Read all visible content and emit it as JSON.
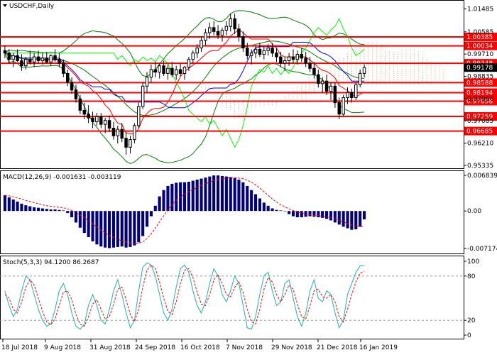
{
  "chart_data": {
    "type": "candlestick-with-indicators",
    "symbol_label": "USDCHF,Daily",
    "price_panel": {
      "ylim": [
        0.9525,
        1.0178
      ],
      "y_ticks": [
        1.01485,
        1.00585,
        0.9971,
        0.98835,
        0.9796,
        0.97085,
        0.9621,
        0.95335
      ],
      "y_tick_labels": [
        "1.01485",
        "1.00585",
        "0.99710",
        "0.98835",
        "0.97960",
        "0.97085",
        "0.96210",
        "0.95335"
      ],
      "horizontal_levels": [
        1.00385,
        1.00034,
        0.99348,
        0.98588,
        0.98194,
        0.97858,
        0.97259,
        0.96685
      ],
      "horizontal_level_labels": [
        "1.00385",
        "1.00034",
        "0.99348",
        "0.98588",
        "0.98194",
        "0.97858",
        "0.97259",
        "0.96685"
      ],
      "current_price": 0.99178,
      "current_price_label": "0.99178",
      "candles": [
        [
          0.9985,
          1.0005,
          0.9955,
          0.9975
        ],
        [
          0.9975,
          0.999,
          0.9935,
          0.995
        ],
        [
          0.995,
          0.9975,
          0.992,
          0.9965
        ],
        [
          0.9965,
          0.999,
          0.994,
          0.9945
        ],
        [
          0.9945,
          0.997,
          0.9905,
          0.9925
        ],
        [
          0.9925,
          0.996,
          0.991,
          0.995
        ],
        [
          0.995,
          0.9985,
          0.993,
          0.994
        ],
        [
          0.994,
          0.9975,
          0.992,
          0.996
        ],
        [
          0.996,
          0.9985,
          0.9935,
          0.9945
        ],
        [
          0.9945,
          0.9975,
          0.993,
          0.9955
        ],
        [
          0.9955,
          0.998,
          0.9935,
          0.994
        ],
        [
          0.994,
          0.997,
          0.9925,
          0.9965
        ],
        [
          0.9965,
          0.999,
          0.994,
          0.995
        ],
        [
          0.995,
          0.9975,
          0.992,
          0.9935
        ],
        [
          0.9935,
          0.995,
          0.988,
          0.9895
        ],
        [
          0.9895,
          0.991,
          0.9845,
          0.986
        ],
        [
          0.986,
          0.988,
          0.9815,
          0.983
        ],
        [
          0.983,
          0.985,
          0.978,
          0.9795
        ],
        [
          0.9795,
          0.981,
          0.9735,
          0.975
        ],
        [
          0.975,
          0.978,
          0.9715,
          0.9735
        ],
        [
          0.9735,
          0.977,
          0.97,
          0.972
        ],
        [
          0.972,
          0.9745,
          0.968,
          0.9705
        ],
        [
          0.9705,
          0.974,
          0.969,
          0.9725
        ],
        [
          0.9725,
          0.974,
          0.968,
          0.9695
        ],
        [
          0.9695,
          0.972,
          0.966,
          0.971
        ],
        [
          0.971,
          0.973,
          0.9665,
          0.968
        ],
        [
          0.968,
          0.9705,
          0.9635,
          0.965
        ],
        [
          0.965,
          0.969,
          0.962,
          0.9675
        ],
        [
          0.9675,
          0.97,
          0.9625,
          0.964
        ],
        [
          0.964,
          0.9665,
          0.9575,
          0.9605
        ],
        [
          0.9605,
          0.965,
          0.958,
          0.9635
        ],
        [
          0.9635,
          0.97,
          0.962,
          0.969
        ],
        [
          0.969,
          0.978,
          0.968,
          0.9765
        ],
        [
          0.9765,
          0.986,
          0.9755,
          0.9845
        ],
        [
          0.9845,
          0.99,
          0.982,
          0.988
        ],
        [
          0.988,
          0.993,
          0.986,
          0.991
        ],
        [
          0.991,
          0.994,
          0.988,
          0.99
        ],
        [
          0.99,
          0.9935,
          0.9875,
          0.9925
        ],
        [
          0.9925,
          0.9945,
          0.9885,
          0.9895
        ],
        [
          0.9895,
          0.993,
          0.987,
          0.9915
        ],
        [
          0.9915,
          0.994,
          0.988,
          0.989
        ],
        [
          0.989,
          0.9925,
          0.987,
          0.991
        ],
        [
          0.991,
          0.9935,
          0.9885,
          0.9895
        ],
        [
          0.9895,
          0.9925,
          0.987,
          0.992
        ],
        [
          0.992,
          0.996,
          0.9905,
          0.995
        ],
        [
          0.995,
          0.9985,
          0.9935,
          0.9975
        ],
        [
          0.9975,
          1.001,
          0.9955,
          0.9995
        ],
        [
          0.9995,
          1.004,
          0.998,
          1.0025
        ],
        [
          1.0025,
          1.007,
          1.0005,
          1.0055
        ],
        [
          1.0055,
          1.0095,
          1.003,
          1.0075
        ],
        [
          1.0075,
          1.01,
          1.0045,
          1.006
        ],
        [
          1.006,
          1.0085,
          1.003,
          1.0045
        ],
        [
          1.0045,
          1.0075,
          1.002,
          1.0065
        ],
        [
          1.0065,
          1.01,
          1.0045,
          1.008
        ],
        [
          1.008,
          1.013,
          1.006,
          1.011
        ],
        [
          1.011,
          1.013,
          1.005,
          1.007
        ],
        [
          1.007,
          1.009,
          1.002,
          1.004
        ],
        [
          1.004,
          1.006,
          0.998,
          0.9995
        ],
        [
          0.9995,
          1.0015,
          0.995,
          0.9965
        ],
        [
          0.9965,
          0.999,
          0.993,
          0.9975
        ],
        [
          0.9975,
          1.0005,
          0.9955,
          0.999
        ],
        [
          0.999,
          1.0015,
          0.996,
          0.997
        ],
        [
          0.997,
          1.0,
          0.995,
          0.9985
        ],
        [
          0.9985,
          1.001,
          0.9965,
          0.9995
        ],
        [
          0.9995,
          1.0015,
          0.996,
          0.9975
        ],
        [
          0.9975,
          0.9995,
          0.994,
          0.996
        ],
        [
          0.996,
          0.998,
          0.992,
          0.9935
        ],
        [
          0.9935,
          0.996,
          0.9905,
          0.9945
        ],
        [
          0.9945,
          0.9975,
          0.9925,
          0.996
        ],
        [
          0.996,
          0.999,
          0.9935,
          0.995
        ],
        [
          0.995,
          0.9985,
          0.993,
          0.997
        ],
        [
          0.997,
          0.9995,
          0.994,
          0.9955
        ],
        [
          0.9955,
          0.998,
          0.992,
          0.9935
        ],
        [
          0.9935,
          0.996,
          0.99,
          0.9915
        ],
        [
          0.9915,
          0.994,
          0.9875,
          0.989
        ],
        [
          0.989,
          0.991,
          0.984,
          0.9855
        ],
        [
          0.9855,
          0.988,
          0.982,
          0.9865
        ],
        [
          0.9865,
          0.989,
          0.981,
          0.9825
        ],
        [
          0.9825,
          0.986,
          0.979,
          0.9845
        ],
        [
          0.9845,
          0.986,
          0.976,
          0.978
        ],
        [
          0.978,
          0.98,
          0.9715,
          0.9735
        ],
        [
          0.9735,
          0.981,
          0.9725,
          0.98
        ],
        [
          0.98,
          0.984,
          0.9775,
          0.982
        ],
        [
          0.982,
          0.9835,
          0.978,
          0.98
        ],
        [
          0.98,
          0.986,
          0.979,
          0.985
        ],
        [
          0.985,
          0.991,
          0.984,
          0.9895
        ],
        [
          0.9895,
          0.993,
          0.988,
          0.9918
        ]
      ]
    },
    "macd_panel": {
      "label": "MACD(12,26,9) -0.001631 -0.003119",
      "ylim": [
        -0.008,
        0.0075
      ],
      "y_ticks": [
        0.006839,
        0.0,
        -0.007174
      ],
      "y_tick_labels": [
        "0.006839",
        "0.00",
        "-0.007174"
      ],
      "histogram": [
        0.003,
        0.0026,
        0.0022,
        0.0018,
        0.0014,
        0.0011,
        0.0009,
        0.0007,
        0.0006,
        0.0005,
        0.0004,
        0.0003,
        0.0003,
        0.0002,
        0.0001,
        -0.0004,
        -0.0012,
        -0.0022,
        -0.0032,
        -0.0042,
        -0.005,
        -0.0058,
        -0.0064,
        -0.0068,
        -0.007,
        -0.0071,
        -0.007,
        -0.0069,
        -0.0068,
        -0.007,
        -0.0069,
        -0.0066,
        -0.006,
        -0.0048,
        -0.003,
        -0.001,
        0.001,
        0.0028,
        0.004,
        0.0048,
        0.0052,
        0.0054,
        0.0055,
        0.0055,
        0.0056,
        0.0058,
        0.006,
        0.0062,
        0.0064,
        0.0066,
        0.0068,
        0.0068,
        0.0067,
        0.0066,
        0.0065,
        0.0063,
        0.006,
        0.0055,
        0.0048,
        0.004,
        0.0032,
        0.0024,
        0.0016,
        0.001,
        0.0005,
        0.0002,
        0.0001,
        0.0,
        -0.0006,
        -0.001,
        -0.0012,
        -0.0012,
        -0.0011,
        -0.001,
        -0.0011,
        -0.0012,
        -0.0013,
        -0.0015,
        -0.0018,
        -0.0022,
        -0.0026,
        -0.003,
        -0.0033,
        -0.0036,
        -0.0035,
        -0.003,
        -0.0016
      ],
      "signal": [
        0.003,
        0.0029,
        0.0027,
        0.0025,
        0.0023,
        0.002,
        0.0018,
        0.0016,
        0.0014,
        0.0012,
        0.001,
        0.0009,
        0.0008,
        0.0007,
        0.0006,
        0.0004,
        0.0001,
        -0.0003,
        -0.0008,
        -0.0013,
        -0.0019,
        -0.0025,
        -0.0031,
        -0.0037,
        -0.0042,
        -0.0047,
        -0.0051,
        -0.0054,
        -0.0057,
        -0.0059,
        -0.0061,
        -0.0062,
        -0.0062,
        -0.0059,
        -0.0053,
        -0.0044,
        -0.0033,
        -0.0021,
        -0.0009,
        0.0002,
        0.0012,
        0.002,
        0.0027,
        0.0032,
        0.0037,
        0.0041,
        0.0045,
        0.0049,
        0.0052,
        0.0055,
        0.0058,
        0.006,
        0.0062,
        0.0063,
        0.0064,
        0.0064,
        0.0063,
        0.0062,
        0.0059,
        0.0055,
        0.005,
        0.0044,
        0.0037,
        0.003,
        0.0023,
        0.0017,
        0.0012,
        0.0008,
        0.0004,
        0.0001,
        -0.0002,
        -0.0004,
        -0.0006,
        -0.0007,
        -0.0008,
        -0.0009,
        -0.001,
        -0.0011,
        -0.0013,
        -0.0015,
        -0.0018,
        -0.0021,
        -0.0024,
        -0.0027,
        -0.0029,
        -0.003,
        -0.003
      ]
    },
    "stoch_panel": {
      "label": "Stoch(5,3,3) 94.1200 86.2687",
      "ylim": [
        0,
        100
      ],
      "y_ticks": [
        100,
        80,
        20,
        0
      ],
      "y_tick_labels": [
        "100",
        "80",
        "20",
        "0"
      ],
      "levels": [
        80,
        20
      ],
      "main": [
        60,
        40,
        25,
        35,
        60,
        80,
        75,
        55,
        35,
        20,
        12,
        15,
        35,
        60,
        70,
        55,
        30,
        12,
        8,
        15,
        40,
        55,
        40,
        20,
        15,
        35,
        60,
        75,
        55,
        30,
        10,
        20,
        60,
        92,
        98,
        95,
        80,
        55,
        30,
        20,
        35,
        65,
        90,
        95,
        85,
        60,
        40,
        30,
        45,
        70,
        90,
        80,
        55,
        45,
        60,
        80,
        70,
        40,
        10,
        8,
        25,
        55,
        80,
        85,
        60,
        40,
        45,
        70,
        75,
        50,
        25,
        12,
        30,
        60,
        75,
        50,
        45,
        60,
        55,
        30,
        10,
        20,
        55,
        70,
        85,
        94,
        94
      ],
      "signal": [
        55,
        50,
        35,
        30,
        45,
        65,
        75,
        68,
        50,
        32,
        18,
        14,
        22,
        40,
        58,
        60,
        48,
        28,
        15,
        12,
        25,
        42,
        48,
        35,
        22,
        25,
        42,
        62,
        65,
        48,
        28,
        18,
        35,
        65,
        88,
        95,
        90,
        72,
        50,
        32,
        28,
        45,
        70,
        88,
        90,
        78,
        58,
        42,
        40,
        55,
        75,
        82,
        70,
        55,
        52,
        65,
        72,
        58,
        35,
        18,
        15,
        35,
        62,
        78,
        72,
        55,
        45,
        55,
        68,
        62,
        42,
        25,
        22,
        40,
        60,
        62,
        52,
        50,
        55,
        45,
        25,
        18,
        35,
        55,
        72,
        84,
        86
      ]
    },
    "x_axis": {
      "tick_labels": [
        "18 Jul 2018",
        "9 Aug 2018",
        "31 Aug 2018",
        "24 Sep 2018",
        "16 Oct 2018",
        "7 Nov 2018",
        "29 Nov 2018",
        "21 Dec 2018",
        "16 Jan 2019"
      ],
      "tick_indices": [
        0,
        15,
        31,
        47,
        63,
        79,
        95,
        111,
        126
      ]
    },
    "colors": {
      "background": "#ffffff",
      "candle": "#000000",
      "level_line": "#ff0000",
      "level_label_bg": "#ff0000",
      "bollinger": "#008000",
      "ma_fast": "#ff0000",
      "ma_slow": "#0000ff",
      "envelope": "#00ff00",
      "ichimoku_cloud_a": "#f4a460",
      "ichimoku_cloud_b": "#dda0dd",
      "current_price_bg": "#000000",
      "macd_hist": "#000080",
      "macd_signal": "#ff0000",
      "stoch_main": "#20b2aa",
      "stoch_signal": "#ff0000",
      "panel_border": "#000000"
    }
  }
}
